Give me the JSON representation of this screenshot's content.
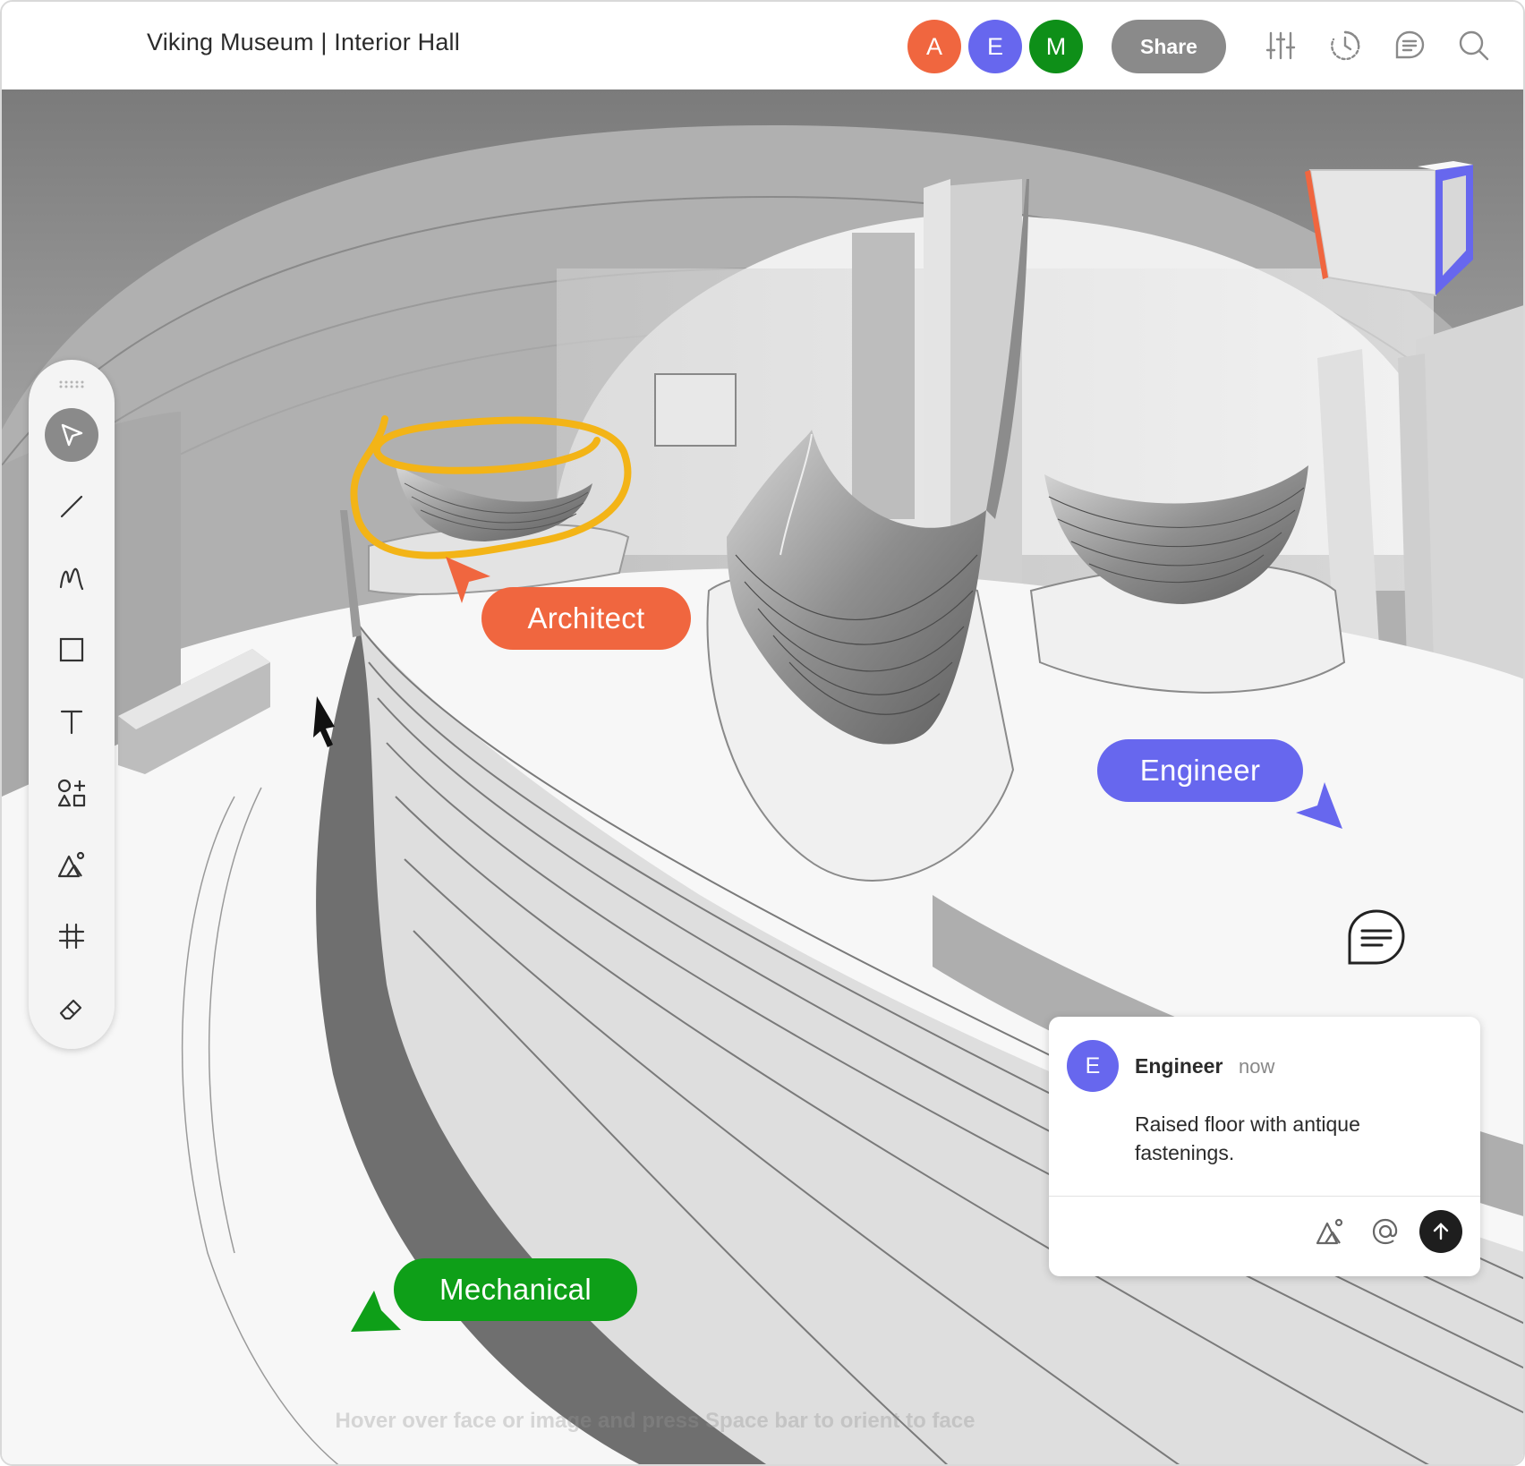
{
  "document": {
    "title": "Viking Museum | Interior Hall"
  },
  "collaborators": [
    {
      "initial": "A",
      "color": "#f0663f"
    },
    {
      "initial": "E",
      "color": "#6767ee"
    },
    {
      "initial": "M",
      "color": "#0e8f18"
    }
  ],
  "topbar": {
    "share_label": "Share",
    "icons": [
      "sliders-icon",
      "history-icon",
      "comments-icon",
      "search-icon"
    ]
  },
  "toolbar": {
    "tools": [
      "select-tool",
      "line-tool",
      "freehand-tool",
      "rectangle-tool",
      "text-tool",
      "shapes-tool",
      "image-tool",
      "grid-tool",
      "eraser-tool"
    ],
    "active": "select-tool"
  },
  "annotations": {
    "architect": {
      "label": "Architect",
      "color": "#f0663f"
    },
    "engineer": {
      "label": "Engineer",
      "color": "#6767ee"
    },
    "mechanical": {
      "label": "Mechanical",
      "color": "#0e9f18"
    },
    "highlight_color": "#f3b417"
  },
  "comment": {
    "author_initial": "E",
    "author": "Engineer",
    "time": "now",
    "body": "Raised floor with antique fastenings.",
    "actions": [
      "image-icon",
      "mention-icon",
      "send-icon"
    ]
  },
  "hint": "Hover over face or image and press Space bar to orient to face"
}
